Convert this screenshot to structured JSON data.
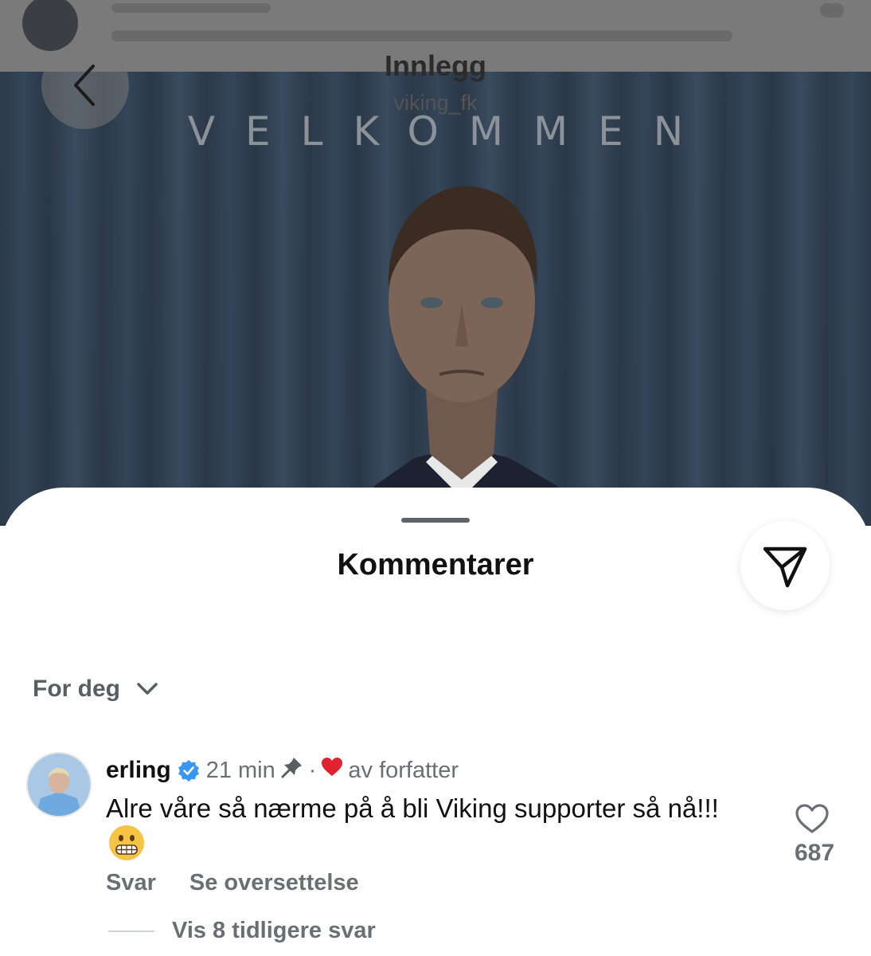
{
  "header": {
    "title": "Innlegg",
    "subtitle": "viking_fk",
    "back_icon": "chevron-left-icon"
  },
  "post": {
    "banner_text": "VELKOMMEN"
  },
  "sheet": {
    "title": "Kommentarer",
    "share_icon": "send-icon",
    "sort_label": "For deg"
  },
  "comment": {
    "username": "erling",
    "verified": true,
    "time": "21 min",
    "pinned_icon": "pin-icon",
    "separator": "·",
    "liked_by_author": "av forfatter",
    "text": "Alre våre så nærme på å bli Viking supporter så nå!!!",
    "emoji": "grimacing-face",
    "like_count": "687",
    "reply_label": "Svar",
    "translate_label": "Se oversettelse",
    "view_replies_label": "Vis 8 tidligere svar"
  },
  "colors": {
    "heart_red": "#e0232e",
    "verified_blue": "#3897f0",
    "text_primary": "#111111",
    "text_secondary": "#6b6f73"
  }
}
